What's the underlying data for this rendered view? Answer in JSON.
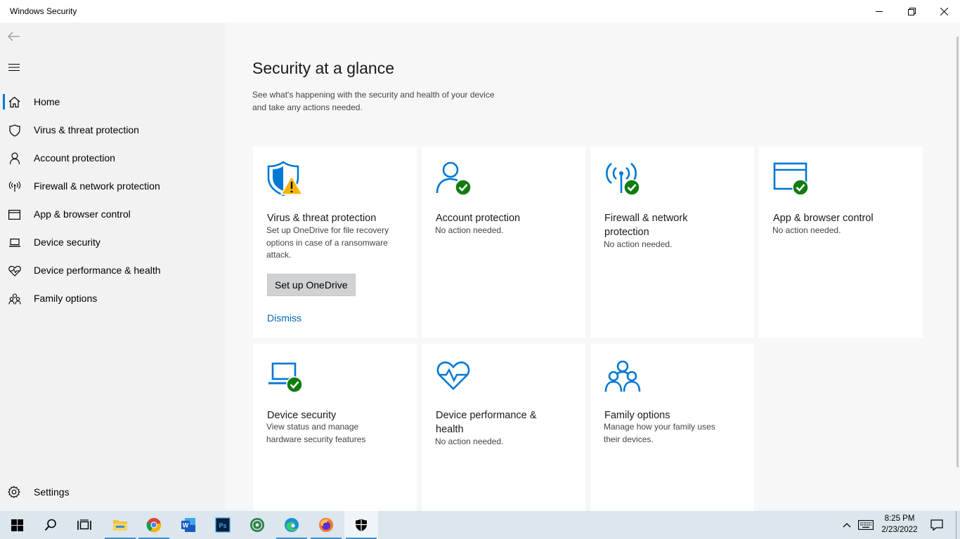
{
  "window": {
    "title": "Windows Security"
  },
  "sidebar": {
    "items": [
      {
        "label": "Home",
        "icon": "home-icon",
        "active": true
      },
      {
        "label": "Virus & threat protection",
        "icon": "shield-icon"
      },
      {
        "label": "Account protection",
        "icon": "person-icon"
      },
      {
        "label": "Firewall & network protection",
        "icon": "antenna-icon"
      },
      {
        "label": "App & browser control",
        "icon": "browser-window-icon"
      },
      {
        "label": "Device security",
        "icon": "laptop-icon"
      },
      {
        "label": "Device performance & health",
        "icon": "heart-pulse-icon"
      },
      {
        "label": "Family options",
        "icon": "family-icon"
      }
    ],
    "settings_label": "Settings"
  },
  "main": {
    "title": "Security at a glance",
    "description_line1": "See what's happening with the security and health of your device",
    "description_line2": "and take any actions needed.",
    "tiles": [
      {
        "title": "Virus & threat protection",
        "desc_lines": [
          "Set up OneDrive for file recovery",
          "options in case of a ransomware",
          "attack."
        ],
        "button": "Set up OneDrive",
        "link": "Dismiss",
        "status": "warning"
      },
      {
        "title": "Account protection",
        "desc_lines": [
          "No action needed."
        ],
        "status": "ok"
      },
      {
        "title_lines": [
          "Firewall & network",
          "protection"
        ],
        "desc_lines": [
          "No action needed."
        ],
        "status": "ok"
      },
      {
        "title": "App & browser control",
        "desc_lines": [
          "No action needed."
        ],
        "status": "ok"
      },
      {
        "title": "Device security",
        "desc_lines": [
          "View status and manage",
          "hardware security features"
        ],
        "status": "ok"
      },
      {
        "title_lines": [
          "Device performance &",
          "health"
        ],
        "desc_lines": [
          "No action needed."
        ]
      },
      {
        "title": "Family options",
        "desc_lines": [
          "Manage how your family uses",
          "their devices."
        ]
      }
    ]
  },
  "taskbar": {
    "apps": [
      "start-icon",
      "search-icon",
      "task-view-icon",
      "file-explorer-icon",
      "chrome-icon",
      "word-icon",
      "photoshop-icon",
      "app-icon",
      "edge-icon",
      "firefox-icon",
      "windows-security-icon"
    ],
    "time": "8:25 PM",
    "date": "2/23/2022"
  },
  "colors": {
    "accent": "#0078d4",
    "ok": "#107c10",
    "warning": "#f7b500"
  }
}
